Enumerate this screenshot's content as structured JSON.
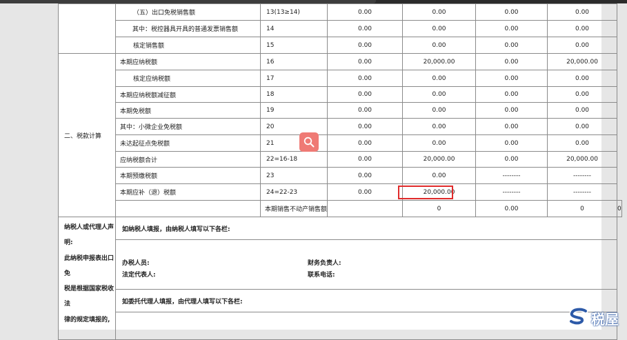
{
  "rows": [
    {
      "project": "（五）出口免税销售额",
      "line": "13(13≥14)",
      "c1": "0.00",
      "c2": "0.00",
      "c3": "0.00",
      "c4": "0.00"
    },
    {
      "project": "其中：税控器具开具的普通发票销售额",
      "line": "14",
      "c1": "0.00",
      "c2": "0.00",
      "c3": "0.00",
      "c4": "0.00"
    },
    {
      "project": "核定销售额",
      "line": "15",
      "c1": "0.00",
      "c2": "0.00",
      "c3": "0.00",
      "c4": "0.00"
    },
    {
      "project": "本期应纳税额",
      "line": "16",
      "c1": "0.00",
      "c2": "20,000.00",
      "c3": "0.00",
      "c4": "20,000.00"
    },
    {
      "project": "核定应纳税额",
      "line": "17",
      "c1": "0.00",
      "c2": "0.00",
      "c3": "0.00",
      "c4": "0.00"
    },
    {
      "project": "本期应纳税额减征额",
      "line": "18",
      "c1": "0.00",
      "c2": "0.00",
      "c3": "0.00",
      "c4": "0.00"
    },
    {
      "project": "本期免税额",
      "line": "19",
      "c1": "0.00",
      "c2": "0.00",
      "c3": "0.00",
      "c4": "0.00"
    },
    {
      "project": "其中：小微企业免税额",
      "line": "20",
      "c1": "0.00",
      "c2": "0.00",
      "c3": "0.00",
      "c4": "0.00"
    },
    {
      "project": "未达起征点免税额",
      "line": "21",
      "c1": "0.00",
      "c2": "0.00",
      "c3": "0.00",
      "c4": "0.00"
    },
    {
      "project": "应纳税额合计",
      "line": "22=16-18",
      "c1": "0.00",
      "c2": "20,000.00",
      "c3": "0.00",
      "c4": "20,000.00"
    },
    {
      "project": "本期预缴税额",
      "line": "23",
      "c1": "0.00",
      "c2": "0.00",
      "c3": "--------",
      "c4": "--------"
    },
    {
      "project": "本期应补（退）税额",
      "line": "24=22-23",
      "c1": "0.00",
      "c2": "20,000.00",
      "c3": "--------",
      "c4": "--------"
    },
    {
      "project": "本期销售不动产销售额",
      "line": "",
      "c1": "0",
      "c2": "0.00",
      "c3": "0",
      "c4": "0"
    }
  ],
  "section_label": "二、税款计算",
  "declaration": {
    "left_lines": [
      "纳税人或代理人声",
      "明:",
      "此纳税申报表出口",
      "免",
      "税是根据国家税收",
      "法",
      "律的规定填报的,"
    ],
    "taxpayer_heading": "如纳税人填报，由纳税人填写以下各栏:",
    "handler": "办税人员:",
    "finance": "财务负责人:",
    "legal_rep": "法定代表人:",
    "phone": "联系电话:",
    "agent_heading": "如委托代理人填报，由代理人填写以下各栏:"
  },
  "brand": {
    "name": "税屋",
    "color": "#2d5aa8"
  }
}
